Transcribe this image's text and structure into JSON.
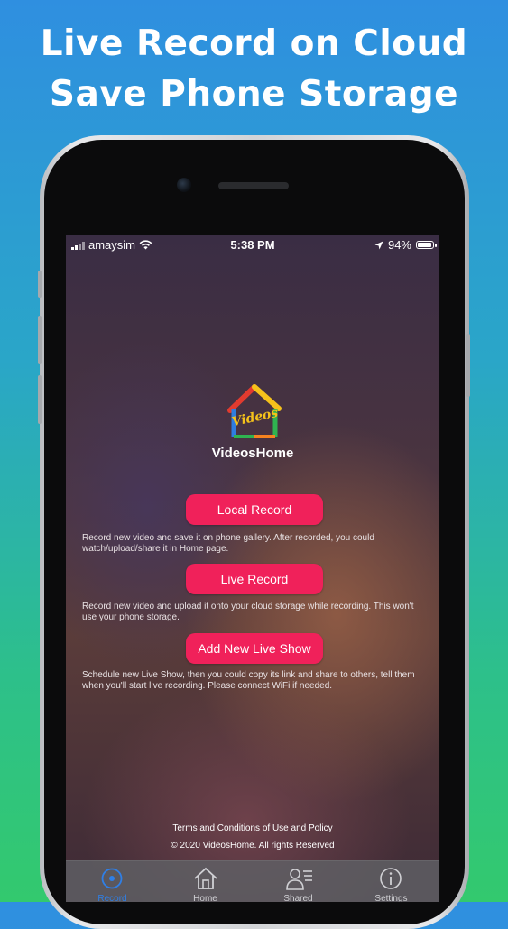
{
  "headline": {
    "line1": "Live Record on Cloud",
    "line2": "Save Phone Storage"
  },
  "status_bar": {
    "carrier": "amaysim",
    "time": "5:38 PM",
    "battery": "94%",
    "battery_level": 0.94
  },
  "app": {
    "name": "VideosHome",
    "logo_text": "Videos"
  },
  "actions": [
    {
      "label": "Local Record",
      "description": "Record new video and save it on phone gallery. After recorded, you could watch/upload/share it in Home page."
    },
    {
      "label": "Live Record",
      "description": "Record new video and upload it onto your cloud storage while recording. This won't use your phone storage."
    },
    {
      "label": "Add New Live Show",
      "description": "Schedule new Live Show, then you could copy its link and share to others, tell them when you'll start live recording. Please connect WiFi if needed."
    }
  ],
  "footer": {
    "terms": "Terms and Conditions of Use and Policy",
    "copyright": "© 2020 VideosHome. All rights Reserved"
  },
  "tabs": [
    {
      "label": "Record",
      "icon": "record-icon",
      "active": true
    },
    {
      "label": "Home",
      "icon": "home-icon",
      "active": false
    },
    {
      "label": "Shared",
      "icon": "shared-icon",
      "active": false
    },
    {
      "label": "Settings",
      "icon": "info-icon",
      "active": false
    }
  ],
  "colors": {
    "accent": "#f0215a",
    "active_tab": "#2f7fe6"
  }
}
